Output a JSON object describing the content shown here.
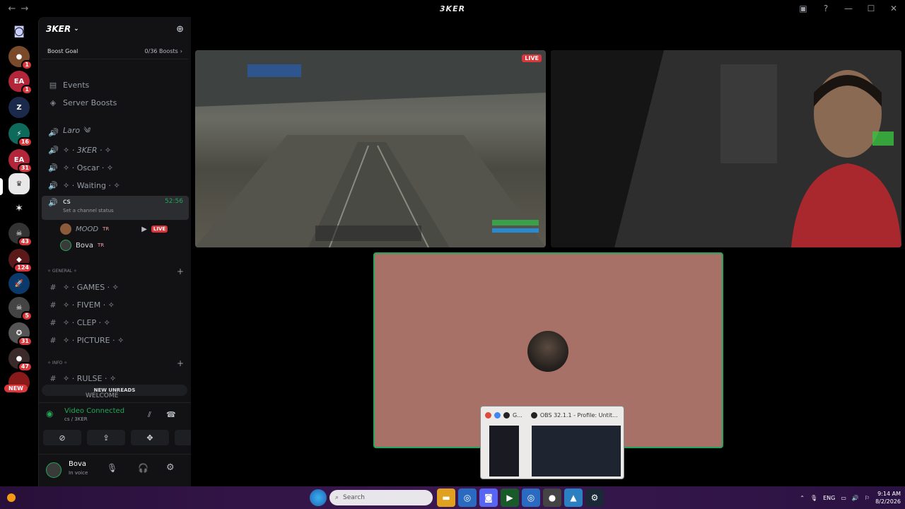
{
  "titlebar": {
    "title": "3KER",
    "back": "←",
    "forward": "→"
  },
  "rail": {
    "badges": [
      "1",
      "1",
      "16",
      "31",
      "43",
      "124",
      "5",
      "31",
      "47"
    ],
    "new_label": "NEW"
  },
  "server": {
    "name": "3KER",
    "boost_label": "Boost Goal",
    "boost_count": "0/36 Boosts",
    "events": "Events",
    "server_boosts": "Server Boosts",
    "voice_channels": [
      "Laro ༄",
      "✧ · 3KER · ✧",
      "✧ · Oscar · ✧",
      "✧ · Waiting · ✧"
    ],
    "active_channel": {
      "name": "cs",
      "time": "52:56",
      "status": "Set a channel status"
    },
    "members": [
      {
        "name": "MOOD",
        "tag": "TR",
        "live": "LIVE"
      },
      {
        "name": "Bova",
        "tag": "TR"
      }
    ],
    "cat_general": "✧ GENERAL ✧",
    "text_channels": [
      "✧ · GAMES · ✧",
      "✧ · FIVEM · ✧",
      "✧ · CLEP · ✧",
      "✧ · PICTURE · ✧"
    ],
    "cat_info": "✧ INFO ✧",
    "rules": "✧ · RULSE · ✧",
    "welcome": "WELCOME",
    "new_unreads": "NEW UNREADS"
  },
  "voice": {
    "status": "Video Connected",
    "location": "cs / 3KER"
  },
  "user": {
    "name": "Bova",
    "status": "In voice"
  },
  "stream": {
    "live": "LIVE"
  },
  "thumbnail": {
    "label": "OBS 32.1.1 - Profile: Untit...",
    "short": "G..."
  },
  "taskbar": {
    "search_placeholder": "Search",
    "lang": "ENG",
    "time": "9:14 AM",
    "date": "8/2/2026"
  },
  "colors": {
    "green": "#23a55a",
    "red": "#da373c",
    "tile": "#a87168"
  }
}
